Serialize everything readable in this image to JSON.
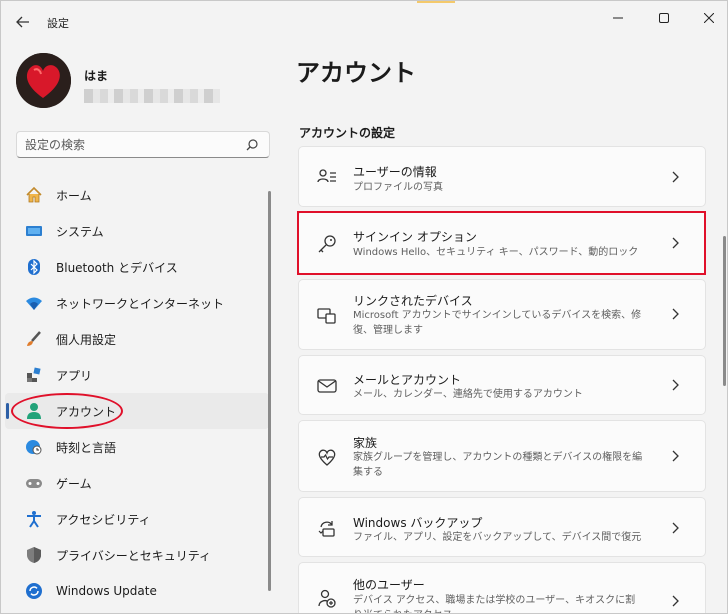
{
  "window": {
    "title": "設定",
    "back_icon": "back-arrow-icon",
    "controls": [
      "minimize-icon",
      "maximize-icon",
      "close-icon"
    ]
  },
  "profile": {
    "name": "はま",
    "avatar_icon": "red-heart-avatar"
  },
  "search": {
    "placeholder": "設定の検索",
    "icon": "search-icon"
  },
  "sidebar": {
    "items": [
      {
        "label": "ホーム",
        "icon": "home-icon",
        "selected": false
      },
      {
        "label": "システム",
        "icon": "system-icon",
        "selected": false
      },
      {
        "label": "Bluetooth とデバイス",
        "icon": "bluetooth-icon",
        "selected": false
      },
      {
        "label": "ネットワークとインターネット",
        "icon": "wifi-icon",
        "selected": false
      },
      {
        "label": "個人用設定",
        "icon": "brush-icon",
        "selected": false
      },
      {
        "label": "アプリ",
        "icon": "apps-icon",
        "selected": false
      },
      {
        "label": "アカウント",
        "icon": "account-icon",
        "selected": true
      },
      {
        "label": "時刻と言語",
        "icon": "time-language-icon",
        "selected": false
      },
      {
        "label": "ゲーム",
        "icon": "gaming-icon",
        "selected": false
      },
      {
        "label": "アクセシビリティ",
        "icon": "accessibility-icon",
        "selected": false
      },
      {
        "label": "プライバシーとセキュリティ",
        "icon": "shield-icon",
        "selected": false
      },
      {
        "label": "Windows Update",
        "icon": "update-icon",
        "selected": false
      }
    ]
  },
  "main": {
    "title": "アカウント",
    "section": "アカウントの設定",
    "cards": [
      {
        "title": "ユーザーの情報",
        "desc": "プロファイルの写真",
        "icon": "user-info-icon"
      },
      {
        "title": "サインイン オプション",
        "desc": "Windows Hello、セキュリティ キー、パスワード、動的ロック",
        "icon": "key-icon"
      },
      {
        "title": "リンクされたデバイス",
        "desc": "Microsoft アカウントでサインインしているデバイスを検索、修復、管理します",
        "icon": "linked-devices-icon"
      },
      {
        "title": "メールとアカウント",
        "desc": "メール、カレンダー、連絡先で使用するアカウント",
        "icon": "mail-icon"
      },
      {
        "title": "家族",
        "desc": "家族グループを管理し、アカウントの種類とデバイスの権限を編集する",
        "icon": "family-heart-icon"
      },
      {
        "title": "Windows バックアップ",
        "desc": "ファイル、アプリ、設定をバックアップして、デバイス間で復元",
        "icon": "backup-icon"
      },
      {
        "title": "他のユーザー",
        "desc": "デバイス アクセス、職場または学校のユーザー、キオスクに割り当てられたアクセス",
        "icon": "other-users-icon"
      }
    ]
  },
  "colors": {
    "accent": "#2d5fa6",
    "highlight": "#e0102a",
    "background": "#f3f3f3",
    "card": "#fbfbfb"
  }
}
